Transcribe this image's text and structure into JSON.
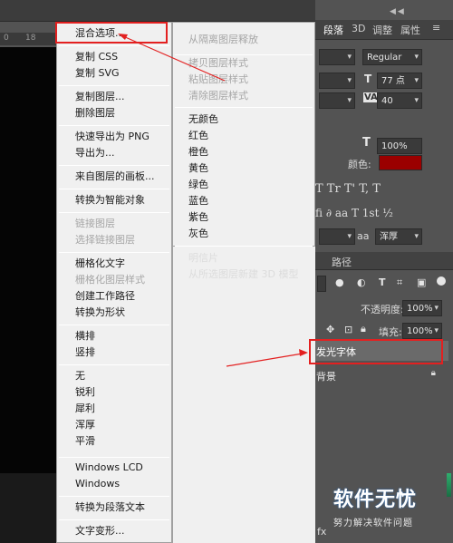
{
  "ruler": {
    "tick": "18"
  },
  "panel": {
    "tabs": [
      "段落",
      "3D",
      "调整",
      "属性"
    ],
    "font_style": "Regular",
    "font_size": "77 点",
    "tracking": "40",
    "vertical_scale": "100%",
    "color_label": "颜色:",
    "color_value": "#9b0000",
    "type_row1": "T  Tr  T'  T,  T",
    "type_row2": "fi  ∂  aa  T  1st  ½",
    "aa_label": "aa",
    "aa_value": "浑厚",
    "layers_tab": "路径",
    "opacity_label": "不透明度:",
    "opacity_value": "100%",
    "fill_label": "填充:",
    "fill_value": "100%",
    "layers": [
      {
        "name": "发光字体"
      },
      {
        "name": "背景"
      }
    ],
    "bottom_fx": "fx"
  },
  "menu_left": {
    "items": [
      {
        "label": "混合选项...",
        "disabled": false
      },
      {
        "label": "复制 CSS",
        "disabled": false
      },
      {
        "label": "复制 SVG",
        "disabled": false
      },
      {
        "label": "复制图层...",
        "disabled": false
      },
      {
        "label": "删除图层",
        "disabled": false
      },
      {
        "label": "快速导出为 PNG",
        "disabled": false
      },
      {
        "label": "导出为...",
        "disabled": false
      },
      {
        "label": "来自图层的画板...",
        "disabled": false
      },
      {
        "label": "转换为智能对象",
        "disabled": false
      },
      {
        "label": "链接图层",
        "disabled": true
      },
      {
        "label": "选择链接图层",
        "disabled": true
      },
      {
        "label": "栅格化文字",
        "disabled": false
      },
      {
        "label": "栅格化图层样式",
        "disabled": true
      },
      {
        "label": "创建工作路径",
        "disabled": false
      },
      {
        "label": "转换为形状",
        "disabled": false
      },
      {
        "label": "横排",
        "disabled": false
      },
      {
        "label": "竖排",
        "disabled": false
      },
      {
        "label": "无",
        "disabled": false
      },
      {
        "label": "锐利",
        "disabled": false
      },
      {
        "label": "犀利",
        "disabled": false
      },
      {
        "label": "浑厚",
        "disabled": false
      },
      {
        "label": "平滑",
        "disabled": false
      },
      {
        "label": "Windows LCD",
        "disabled": false
      },
      {
        "label": "Windows",
        "disabled": false
      },
      {
        "label": "转换为段落文本",
        "disabled": false
      },
      {
        "label": "文字变形...",
        "disabled": false
      }
    ]
  },
  "menu_right": {
    "items": [
      {
        "label": "从隔离图层释放",
        "disabled": true
      },
      {
        "label": "拷贝图层样式",
        "disabled": true
      },
      {
        "label": "粘贴图层样式",
        "disabled": true
      },
      {
        "label": "清除图层样式",
        "disabled": true
      },
      {
        "label": "无颜色",
        "disabled": false
      },
      {
        "label": "红色",
        "disabled": false
      },
      {
        "label": "橙色",
        "disabled": false
      },
      {
        "label": "黄色",
        "disabled": false
      },
      {
        "label": "绿色",
        "disabled": false
      },
      {
        "label": "蓝色",
        "disabled": false
      },
      {
        "label": "紫色",
        "disabled": false
      },
      {
        "label": "灰色",
        "disabled": false
      },
      {
        "label": "明信片",
        "disabled": false
      },
      {
        "label": "从所选图层新建 3D 模型",
        "disabled": false
      }
    ]
  },
  "watermark": {
    "main": "软件无忧",
    "sub": "努力解决软件问题"
  },
  "colors": {
    "annotation": "#e32020",
    "layer_selected": "#6a6a6a",
    "menu_bg": "#f0f0f0"
  }
}
